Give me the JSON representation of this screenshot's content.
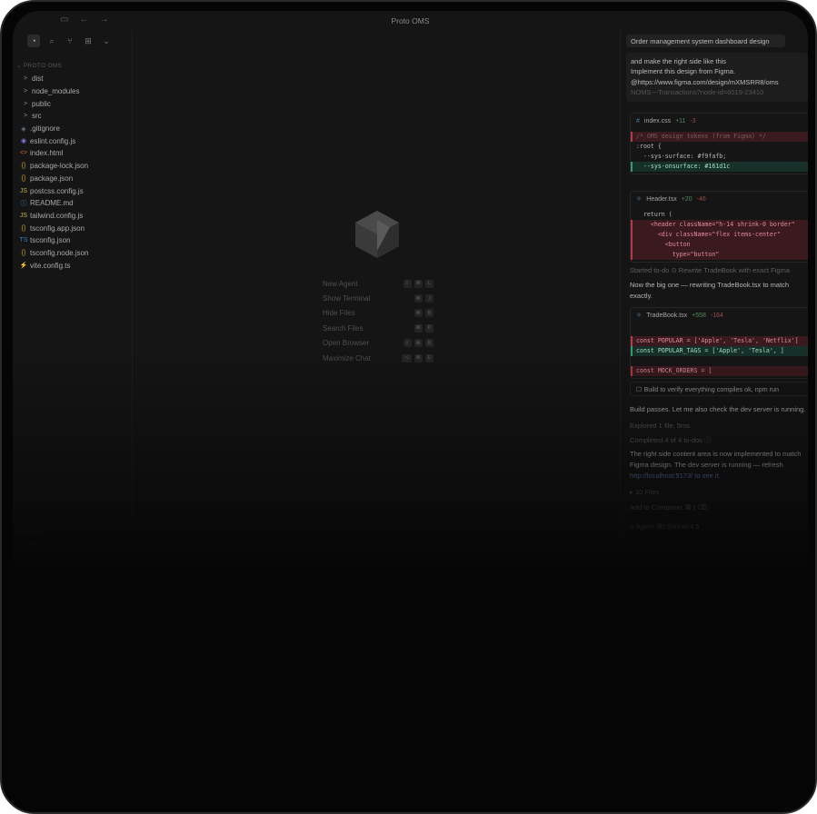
{
  "window": {
    "title": "Proto OMS"
  },
  "sidebar": {
    "section_label": "PROTO OMS",
    "items": [
      {
        "label": "dist",
        "type": "folder",
        "icon": ">",
        "color": "#8a8a8a"
      },
      {
        "label": "node_modules",
        "type": "folder",
        "icon": ">",
        "color": "#8a8a8a"
      },
      {
        "label": "public",
        "type": "folder",
        "icon": ">",
        "color": "#8a8a8a"
      },
      {
        "label": "src",
        "type": "folder",
        "icon": ">",
        "color": "#8a8a8a"
      },
      {
        "label": ".gitignore",
        "type": "file",
        "icon": "◈",
        "color": "#6d7f8f"
      },
      {
        "label": "eslint.config.js",
        "type": "file",
        "icon": "◉",
        "color": "#8b6fd1"
      },
      {
        "label": "index.html",
        "type": "file",
        "icon": "<>",
        "color": "#d06a3a"
      },
      {
        "label": "package-lock.json",
        "type": "file",
        "icon": "{}",
        "color": "#c9a43a"
      },
      {
        "label": "package.json",
        "type": "file",
        "icon": "{}",
        "color": "#c9a43a"
      },
      {
        "label": "postcss.config.js",
        "type": "file",
        "icon": "JS",
        "color": "#c9b23a"
      },
      {
        "label": "README.md",
        "type": "file",
        "icon": "ⓘ",
        "color": "#4f8fc9"
      },
      {
        "label": "tailwind.config.js",
        "type": "file",
        "icon": "JS",
        "color": "#c9b23a"
      },
      {
        "label": "tsconfig.app.json",
        "type": "file",
        "icon": "{}",
        "color": "#c9a43a"
      },
      {
        "label": "tsconfig.json",
        "type": "file",
        "icon": "TS",
        "color": "#3a7ac9"
      },
      {
        "label": "tsconfig.node.json",
        "type": "file",
        "icon": "{}",
        "color": "#c9a43a"
      },
      {
        "label": "vite.config.ts",
        "type": "file",
        "icon": "⚡",
        "color": "#d4b13a"
      }
    ],
    "outline_label": "OUTLINE",
    "outline_sub": "TIMELINE"
  },
  "center": {
    "shortcuts": [
      {
        "label": "New Agent",
        "keys": [
          "⇧",
          "⌘",
          "L"
        ]
      },
      {
        "label": "Show Terminal",
        "keys": [
          "⌘",
          "J"
        ]
      },
      {
        "label": "Hide Files",
        "keys": [
          "⌘",
          "B"
        ]
      },
      {
        "label": "Search Files",
        "keys": [
          "⌘",
          "P"
        ]
      },
      {
        "label": "Open Browser",
        "keys": [
          "⇧",
          "⌘",
          "B"
        ]
      },
      {
        "label": "Maximize Chat",
        "keys": [
          "⌥",
          "⌘",
          "E"
        ]
      }
    ]
  },
  "chat": {
    "title": "Order management system dashboard design",
    "prompt_lines": [
      "and make the right side like this",
      "Implement this design from Figma.",
      "@https://www.figma.com/design/mXMSRR8/oms",
      "NOMS---Transactions?node-id=6019-23410"
    ],
    "card1": {
      "file": "index.css",
      "add": "+11",
      "del": "-3",
      "lines": [
        {
          "t": "/* OMS design tokens (from Figma) */",
          "k": "rem com"
        },
        {
          "t": ":root {",
          "k": ""
        },
        {
          "t": "  --sys-surface: #f9fafb;",
          "k": ""
        },
        {
          "t": "  --sys-onsurface: #161d1c",
          "k": "addl"
        }
      ]
    },
    "card2": {
      "file": "Header.tsx",
      "add": "+20",
      "del": "-46",
      "lines": [
        {
          "t": "  return (",
          "k": ""
        },
        {
          "t": "    <header className=\"h-14 shrink-0 border\"",
          "k": "rem"
        },
        {
          "t": "      <div className=\"flex items-center\"",
          "k": "rem"
        },
        {
          "t": "        <button",
          "k": "rem"
        },
        {
          "t": "          type=\"button\"",
          "k": "rem"
        }
      ]
    },
    "started": "Started to-do  ⊙  Rewrite TradeBook with exact Figma",
    "para1_a": "Now the big one — rewriting TradeBook.tsx to match",
    "para1_b": "exactly.",
    "card3": {
      "file": "TradeBook.tsx",
      "add": "+558",
      "del": "-164",
      "lines": [
        {
          "t": "",
          "k": ""
        },
        {
          "t": "const POPULAR = ['Apple', 'Tesla', 'Netflix']",
          "k": "rem"
        },
        {
          "t": "const POPULAR_TAGS = ['Apple', 'Tesla', ]",
          "k": "addl"
        },
        {
          "t": "",
          "k": ""
        },
        {
          "t": "const MOCK_ORDERS = [",
          "k": "rem"
        }
      ]
    },
    "todo": "☐  Build to verify everything compiles ok, npm run",
    "build": "Build passes. Let me also check the dev server is running.",
    "explored": "Explored 1 file, 5ms",
    "completed": "Completed 4 of 4 to-dos  ⓘ",
    "summary1": "The right side content area is now implemented to match",
    "summary2": "Figma design. The dev server is running — refresh",
    "summary3": "http://localhost:5173/ to see it.",
    "files_chip": "▸ 10 Files",
    "review": "Add to Composer  ⌘⇧⌫",
    "agent_chip": "∞ Agent  ⌘I   Sonnet 4.5"
  }
}
